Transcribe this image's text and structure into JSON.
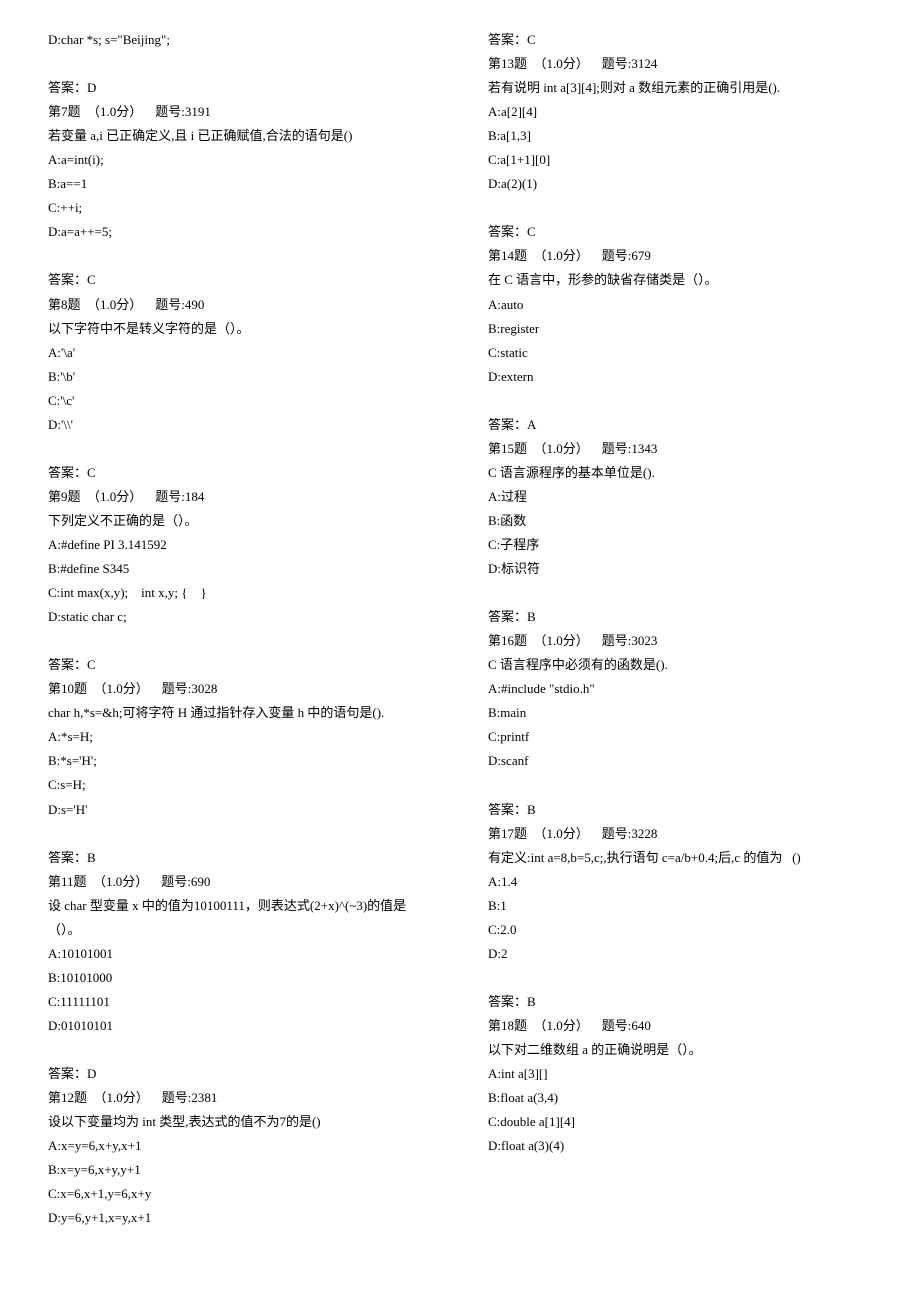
{
  "leading": [
    {
      "label": "D",
      "text": "char *s; s=\"Beijing\";"
    }
  ],
  "leading_answer": "答案：D",
  "questions": [
    {
      "num": 7,
      "points": "1.0分",
      "id": "3191",
      "stem": "若变量 a,i 已正确定义,且 i 已正确赋值,合法的语句是()",
      "options": [
        {
          "label": "A",
          "text": "a=int(i);"
        },
        {
          "label": "B",
          "text": "a==1"
        },
        {
          "label": "C",
          "text": "++i;"
        },
        {
          "label": "D",
          "text": "a=a++=5;"
        }
      ],
      "answer": "答案：C"
    },
    {
      "num": 8,
      "points": "1.0分",
      "id": "490",
      "stem": "以下字符中不是转义字符的是（）。",
      "options": [
        {
          "label": "A",
          "text": "'\\a'"
        },
        {
          "label": "B",
          "text": "'\\b'"
        },
        {
          "label": "C",
          "text": "'\\c'"
        },
        {
          "label": "D",
          "text": "'\\\\'"
        }
      ],
      "answer": "答案：C"
    },
    {
      "num": 9,
      "points": "1.0分",
      "id": "184",
      "stem": "下列定义不正确的是（）。",
      "options": [
        {
          "label": "A",
          "text": "#define PI 3.141592"
        },
        {
          "label": "B",
          "text": "#define S345"
        },
        {
          "label": "C",
          "text": "int max(x,y);    int x,y; {    }"
        },
        {
          "label": "D",
          "text": "static char c;"
        }
      ],
      "answer": "答案：C"
    },
    {
      "num": 10,
      "points": "1.0分",
      "id": "3028",
      "stem": "char h,*s=&h;可将字符 H 通过指针存入变量 h 中的语句是().",
      "options": [
        {
          "label": "A",
          "text": "*s=H;"
        },
        {
          "label": "B",
          "text": "*s='H';"
        },
        {
          "label": "C",
          "text": "s=H;"
        },
        {
          "label": "D",
          "text": "s='H'"
        }
      ],
      "answer": "答案：B"
    },
    {
      "num": 11,
      "points": "1.0分",
      "id": "690",
      "stem": "设 char 型变量 x 中的值为10100111，则表达式(2+x)^(~3)的值是（）。",
      "options": [
        {
          "label": "A",
          "text": "10101001"
        },
        {
          "label": "B",
          "text": "10101000"
        },
        {
          "label": "C",
          "text": "11111101"
        },
        {
          "label": "D",
          "text": "01010101"
        }
      ],
      "answer": "答案：D"
    },
    {
      "num": 12,
      "points": "1.0分",
      "id": "2381",
      "stem": "设以下变量均为 int 类型,表达式的值不为7的是()",
      "options": [
        {
          "label": "A",
          "text": "x=y=6,x+y,x+1"
        },
        {
          "label": "B",
          "text": "x=y=6,x+y,y+1"
        },
        {
          "label": "C",
          "text": "x=6,x+1,y=6,x+y"
        },
        {
          "label": "D",
          "text": "y=6,y+1,x=y,x+1"
        }
      ],
      "answer": "答案：C"
    },
    {
      "num": 13,
      "points": "1.0分",
      "id": "3124",
      "stem": "若有说明 int a[3][4];则对 a 数组元素的正确引用是().",
      "options": [
        {
          "label": "A",
          "text": "a[2][4]"
        },
        {
          "label": "B",
          "text": "a[1,3]"
        },
        {
          "label": "C",
          "text": "a[1+1][0]"
        },
        {
          "label": "D",
          "text": "a(2)(1)"
        }
      ],
      "answer": "答案：C"
    },
    {
      "num": 14,
      "points": "1.0分",
      "id": "679",
      "stem": "在 C 语言中，形参的缺省存储类是（）。",
      "options": [
        {
          "label": "A",
          "text": "auto"
        },
        {
          "label": "B",
          "text": "register"
        },
        {
          "label": "C",
          "text": "static"
        },
        {
          "label": "D",
          "text": "extern"
        }
      ],
      "answer": "答案：A"
    },
    {
      "num": 15,
      "points": "1.0分",
      "id": "1343",
      "stem": "C 语言源程序的基本单位是().",
      "options": [
        {
          "label": "A",
          "text": "过程"
        },
        {
          "label": "B",
          "text": "函数"
        },
        {
          "label": "C",
          "text": "子程序"
        },
        {
          "label": "D",
          "text": "标识符"
        }
      ],
      "answer": "答案：B"
    },
    {
      "num": 16,
      "points": "1.0分",
      "id": "3023",
      "stem": "C 语言程序中必须有的函数是().",
      "options": [
        {
          "label": "A",
          "text": "#include \"stdio.h\""
        },
        {
          "label": "B",
          "text": "main"
        },
        {
          "label": "C",
          "text": "printf"
        },
        {
          "label": "D",
          "text": "scanf"
        }
      ],
      "answer": "答案：B"
    },
    {
      "num": 17,
      "points": "1.0分",
      "id": "3228",
      "stem": "有定义:int a=8,b=5,c;,执行语句 c=a/b+0.4;后,c 的值为   ()",
      "options": [
        {
          "label": "A",
          "text": "1.4"
        },
        {
          "label": "B",
          "text": "1"
        },
        {
          "label": "C",
          "text": "2.0"
        },
        {
          "label": "D",
          "text": "2"
        }
      ],
      "answer": "答案：B"
    },
    {
      "num": 18,
      "points": "1.0分",
      "id": "640",
      "stem": "以下对二维数组 a 的正确说明是（）。",
      "options": [
        {
          "label": "A",
          "text": "int a[3][]"
        },
        {
          "label": "B",
          "text": "float a(3,4)"
        },
        {
          "label": "C",
          "text": "double a[1][4]"
        },
        {
          "label": "D",
          "text": "float a(3)(4)"
        }
      ],
      "answer": ""
    }
  ],
  "labels": {
    "question_prefix": "第",
    "question_suffix": "题",
    "id_prefix": "题号:"
  }
}
